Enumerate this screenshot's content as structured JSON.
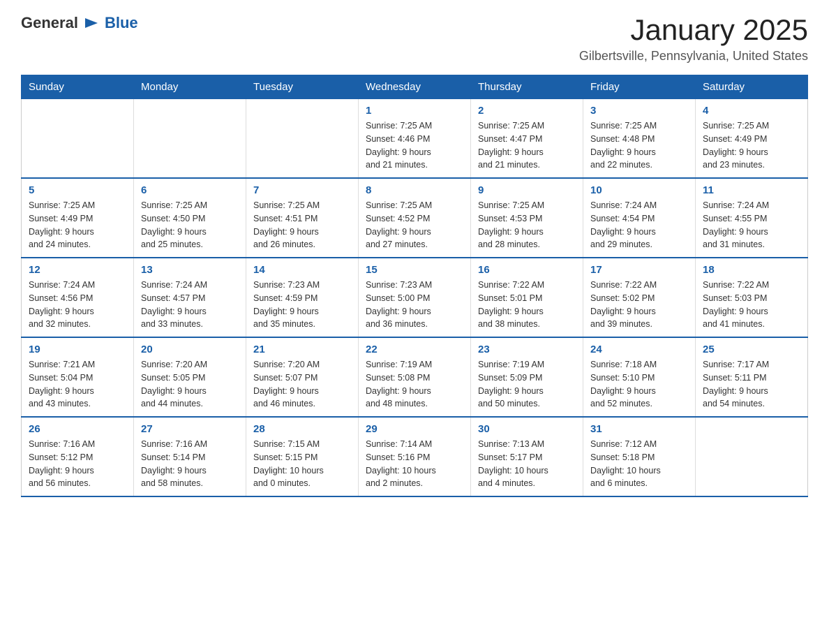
{
  "header": {
    "logo": {
      "general": "General",
      "arrow_symbol": "▶",
      "blue": "Blue"
    },
    "title": "January 2025",
    "location": "Gilbertsville, Pennsylvania, United States"
  },
  "weekdays": [
    "Sunday",
    "Monday",
    "Tuesday",
    "Wednesday",
    "Thursday",
    "Friday",
    "Saturday"
  ],
  "weeks": [
    [
      {
        "day": "",
        "info": ""
      },
      {
        "day": "",
        "info": ""
      },
      {
        "day": "",
        "info": ""
      },
      {
        "day": "1",
        "info": "Sunrise: 7:25 AM\nSunset: 4:46 PM\nDaylight: 9 hours\nand 21 minutes."
      },
      {
        "day": "2",
        "info": "Sunrise: 7:25 AM\nSunset: 4:47 PM\nDaylight: 9 hours\nand 21 minutes."
      },
      {
        "day": "3",
        "info": "Sunrise: 7:25 AM\nSunset: 4:48 PM\nDaylight: 9 hours\nand 22 minutes."
      },
      {
        "day": "4",
        "info": "Sunrise: 7:25 AM\nSunset: 4:49 PM\nDaylight: 9 hours\nand 23 minutes."
      }
    ],
    [
      {
        "day": "5",
        "info": "Sunrise: 7:25 AM\nSunset: 4:49 PM\nDaylight: 9 hours\nand 24 minutes."
      },
      {
        "day": "6",
        "info": "Sunrise: 7:25 AM\nSunset: 4:50 PM\nDaylight: 9 hours\nand 25 minutes."
      },
      {
        "day": "7",
        "info": "Sunrise: 7:25 AM\nSunset: 4:51 PM\nDaylight: 9 hours\nand 26 minutes."
      },
      {
        "day": "8",
        "info": "Sunrise: 7:25 AM\nSunset: 4:52 PM\nDaylight: 9 hours\nand 27 minutes."
      },
      {
        "day": "9",
        "info": "Sunrise: 7:25 AM\nSunset: 4:53 PM\nDaylight: 9 hours\nand 28 minutes."
      },
      {
        "day": "10",
        "info": "Sunrise: 7:24 AM\nSunset: 4:54 PM\nDaylight: 9 hours\nand 29 minutes."
      },
      {
        "day": "11",
        "info": "Sunrise: 7:24 AM\nSunset: 4:55 PM\nDaylight: 9 hours\nand 31 minutes."
      }
    ],
    [
      {
        "day": "12",
        "info": "Sunrise: 7:24 AM\nSunset: 4:56 PM\nDaylight: 9 hours\nand 32 minutes."
      },
      {
        "day": "13",
        "info": "Sunrise: 7:24 AM\nSunset: 4:57 PM\nDaylight: 9 hours\nand 33 minutes."
      },
      {
        "day": "14",
        "info": "Sunrise: 7:23 AM\nSunset: 4:59 PM\nDaylight: 9 hours\nand 35 minutes."
      },
      {
        "day": "15",
        "info": "Sunrise: 7:23 AM\nSunset: 5:00 PM\nDaylight: 9 hours\nand 36 minutes."
      },
      {
        "day": "16",
        "info": "Sunrise: 7:22 AM\nSunset: 5:01 PM\nDaylight: 9 hours\nand 38 minutes."
      },
      {
        "day": "17",
        "info": "Sunrise: 7:22 AM\nSunset: 5:02 PM\nDaylight: 9 hours\nand 39 minutes."
      },
      {
        "day": "18",
        "info": "Sunrise: 7:22 AM\nSunset: 5:03 PM\nDaylight: 9 hours\nand 41 minutes."
      }
    ],
    [
      {
        "day": "19",
        "info": "Sunrise: 7:21 AM\nSunset: 5:04 PM\nDaylight: 9 hours\nand 43 minutes."
      },
      {
        "day": "20",
        "info": "Sunrise: 7:20 AM\nSunset: 5:05 PM\nDaylight: 9 hours\nand 44 minutes."
      },
      {
        "day": "21",
        "info": "Sunrise: 7:20 AM\nSunset: 5:07 PM\nDaylight: 9 hours\nand 46 minutes."
      },
      {
        "day": "22",
        "info": "Sunrise: 7:19 AM\nSunset: 5:08 PM\nDaylight: 9 hours\nand 48 minutes."
      },
      {
        "day": "23",
        "info": "Sunrise: 7:19 AM\nSunset: 5:09 PM\nDaylight: 9 hours\nand 50 minutes."
      },
      {
        "day": "24",
        "info": "Sunrise: 7:18 AM\nSunset: 5:10 PM\nDaylight: 9 hours\nand 52 minutes."
      },
      {
        "day": "25",
        "info": "Sunrise: 7:17 AM\nSunset: 5:11 PM\nDaylight: 9 hours\nand 54 minutes."
      }
    ],
    [
      {
        "day": "26",
        "info": "Sunrise: 7:16 AM\nSunset: 5:12 PM\nDaylight: 9 hours\nand 56 minutes."
      },
      {
        "day": "27",
        "info": "Sunrise: 7:16 AM\nSunset: 5:14 PM\nDaylight: 9 hours\nand 58 minutes."
      },
      {
        "day": "28",
        "info": "Sunrise: 7:15 AM\nSunset: 5:15 PM\nDaylight: 10 hours\nand 0 minutes."
      },
      {
        "day": "29",
        "info": "Sunrise: 7:14 AM\nSunset: 5:16 PM\nDaylight: 10 hours\nand 2 minutes."
      },
      {
        "day": "30",
        "info": "Sunrise: 7:13 AM\nSunset: 5:17 PM\nDaylight: 10 hours\nand 4 minutes."
      },
      {
        "day": "31",
        "info": "Sunrise: 7:12 AM\nSunset: 5:18 PM\nDaylight: 10 hours\nand 6 minutes."
      },
      {
        "day": "",
        "info": ""
      }
    ]
  ]
}
